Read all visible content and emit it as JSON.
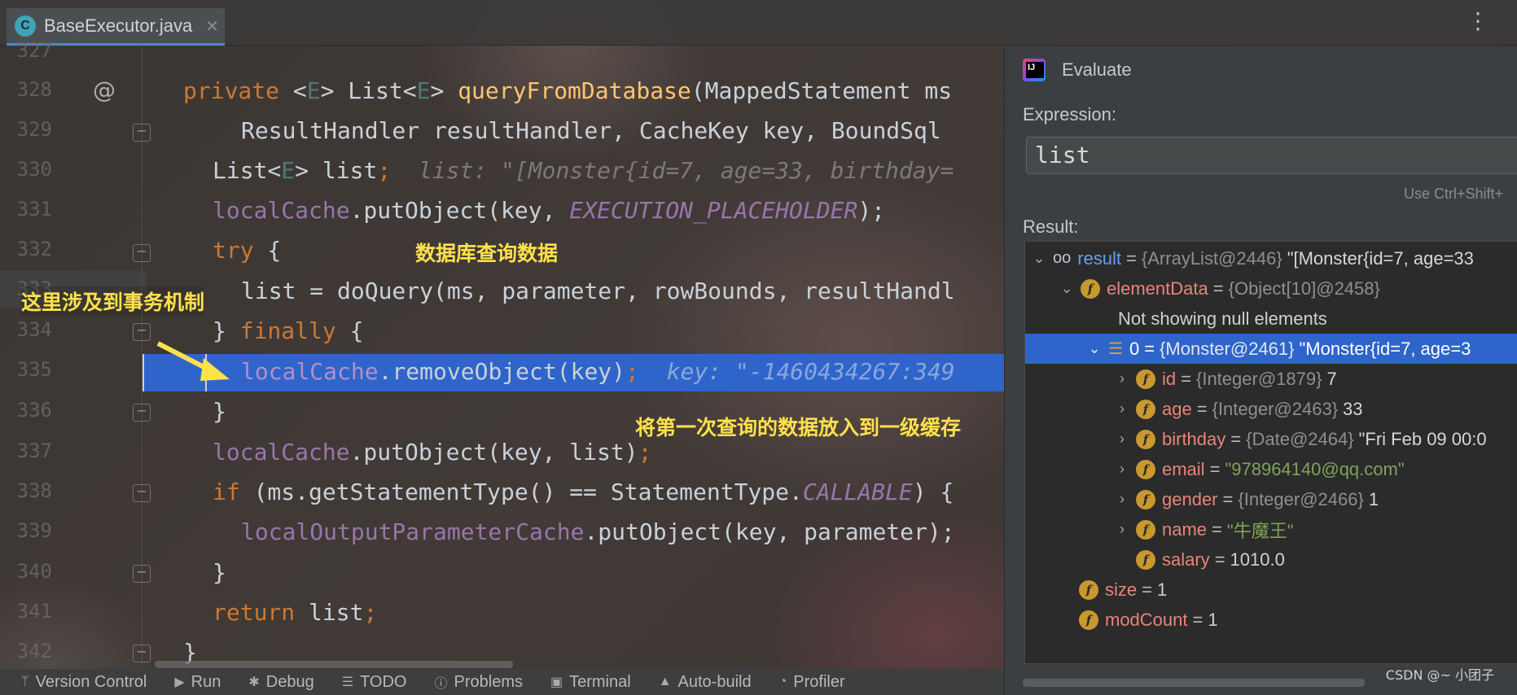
{
  "tab": {
    "icon": "C",
    "label": "BaseExecutor.java",
    "close": "✕"
  },
  "gutter": {
    "lines": [
      "327",
      "328",
      "329",
      "330",
      "331",
      "332",
      "333",
      "334",
      "335",
      "336",
      "337",
      "338",
      "339",
      "340",
      "341",
      "342"
    ]
  },
  "code": {
    "l328": {
      "kw": "private",
      "a": " <",
      "gen": "E",
      "b": "> List<",
      "gen2": "E",
      "c": "> ",
      "fn": "queryFromDatabase",
      "d": "(MappedStatement ms"
    },
    "l329": {
      "a": "ResultHandler resultHandler, CacheKey key, BoundSql"
    },
    "l330": {
      "a": "List<",
      "gen": "E",
      "b": "> list",
      "semi": ";",
      "hint": "list: \"[Monster{id=7, age=33, birthday="
    },
    "l331": {
      "field": "localCache",
      "a": ".putObject(key, ",
      "const": "EXECUTION_PLACEHOLDER",
      "b": ");"
    },
    "l332": {
      "kw": "try",
      "a": " {"
    },
    "l333": {
      "a": "list = doQuery(ms, parameter, rowBounds, resultHandl"
    },
    "l334": {
      "a": "} ",
      "kw": "finally",
      "b": " {"
    },
    "l335": {
      "field": "localCache",
      "a": ".removeObject(key)",
      "semi": ";",
      "hint": "key: \"-1460434267:349"
    },
    "l336": {
      "a": "}"
    },
    "l337": {
      "field": "localCache",
      "a": ".putObject(key, list)",
      "semi": ";"
    },
    "l338": {
      "kw": "if",
      "a": " (ms.getStatementType() == StatementType.",
      "const": "CALLABLE",
      "b": ") {"
    },
    "l339": {
      "field": "localOutputParameterCache",
      "a": ".putObject(key, parameter);"
    },
    "l340": {
      "a": "}"
    },
    "l341": {
      "kw": "return",
      "a": " list",
      "semi": ";"
    },
    "l342": {
      "a": "}"
    }
  },
  "annotations": {
    "db_query": "数据库查询数据",
    "transaction": "这里涉及到事务机制",
    "first_level_cache": "将第一次查询的数据放入到一级缓存"
  },
  "evaluate": {
    "title": "Evaluate",
    "expression_label": "Expression:",
    "expression_value": "list",
    "shortcut_hint": "Use Ctrl+Shift+",
    "result_label": "Result:",
    "tree": {
      "result": {
        "name": "result",
        "type": "{ArrayList@2446}",
        "value": "\"[Monster{id=7, age=33"
      },
      "elementData": {
        "name": "elementData",
        "type": "{Object[10]@2458}"
      },
      "not_showing": "Not showing null elements",
      "item0": {
        "name": "0",
        "type": "{Monster@2461}",
        "value": "\"Monster{id=7, age=3"
      },
      "id": {
        "name": "id",
        "type": "{Integer@1879}",
        "value": "7"
      },
      "age": {
        "name": "age",
        "type": "{Integer@2463}",
        "value": "33"
      },
      "birthday": {
        "name": "birthday",
        "type": "{Date@2464}",
        "value": "\"Fri Feb 09 00:0"
      },
      "email": {
        "name": "email",
        "value": "\"978964140@qq.com\""
      },
      "gender": {
        "name": "gender",
        "type": "{Integer@2466}",
        "value": "1"
      },
      "name": {
        "name": "name",
        "value": "\"牛魔王\""
      },
      "salary": {
        "name": "salary",
        "value": "1010.0"
      },
      "size": {
        "name": "size",
        "value": "1"
      },
      "modCount": {
        "name": "modCount",
        "value": "1"
      }
    }
  },
  "bottombar": {
    "items": [
      "Version Control",
      "Run",
      "Debug",
      "TODO",
      "Problems",
      "Terminal",
      "Auto-build",
      "Profiler"
    ]
  },
  "watermark": "CSDN @~ 小团子",
  "colors": {
    "selection": "#2f65ca",
    "annotation": "#ffe14a",
    "keyword": "#cc7832",
    "field": "#9876aa"
  }
}
